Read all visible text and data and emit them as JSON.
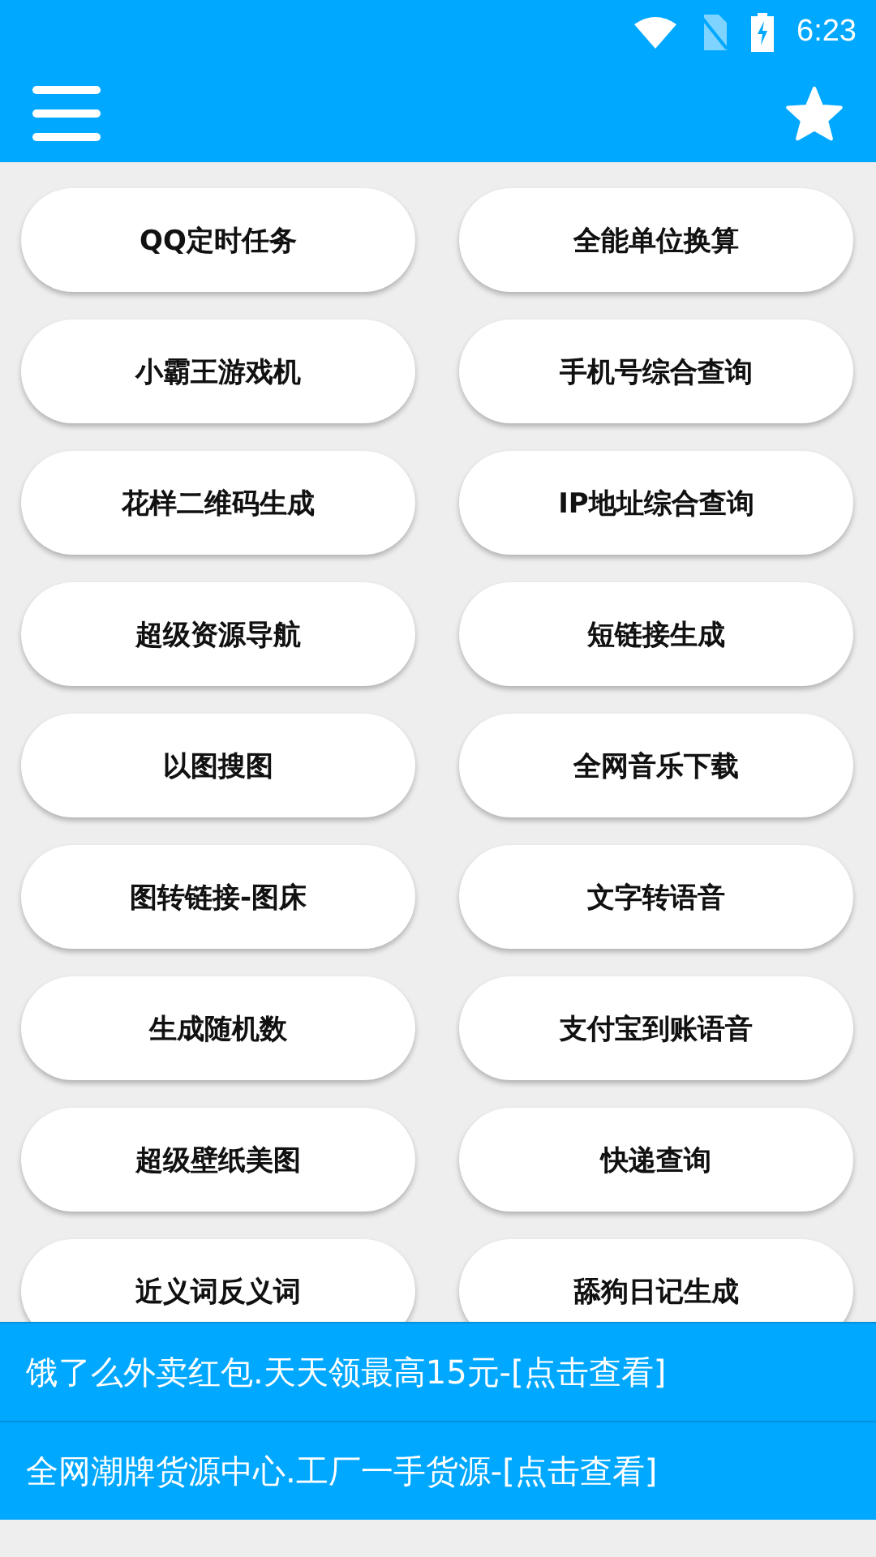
{
  "status_bar": {
    "time": "6:23"
  },
  "tools": [
    {
      "label": "QQ定时任务"
    },
    {
      "label": "全能单位换算"
    },
    {
      "label": "小霸王游戏机"
    },
    {
      "label": "手机号综合查询"
    },
    {
      "label": "花样二维码生成"
    },
    {
      "label": "IP地址综合查询"
    },
    {
      "label": "超级资源导航"
    },
    {
      "label": "短链接生成"
    },
    {
      "label": "以图搜图"
    },
    {
      "label": "全网音乐下载"
    },
    {
      "label": "图转链接-图床"
    },
    {
      "label": "文字转语音"
    },
    {
      "label": "生成随机数"
    },
    {
      "label": "支付宝到账语音"
    },
    {
      "label": "超级壁纸美图"
    },
    {
      "label": "快递查询"
    },
    {
      "label": "近义词反义词"
    },
    {
      "label": "舔狗日记生成"
    }
  ],
  "banners": [
    {
      "text": "饿了么外卖红包.天天领最高15元-[点击查看]"
    },
    {
      "text": "全网潮牌货源中心.工厂一手货源-[点击查看]"
    }
  ]
}
